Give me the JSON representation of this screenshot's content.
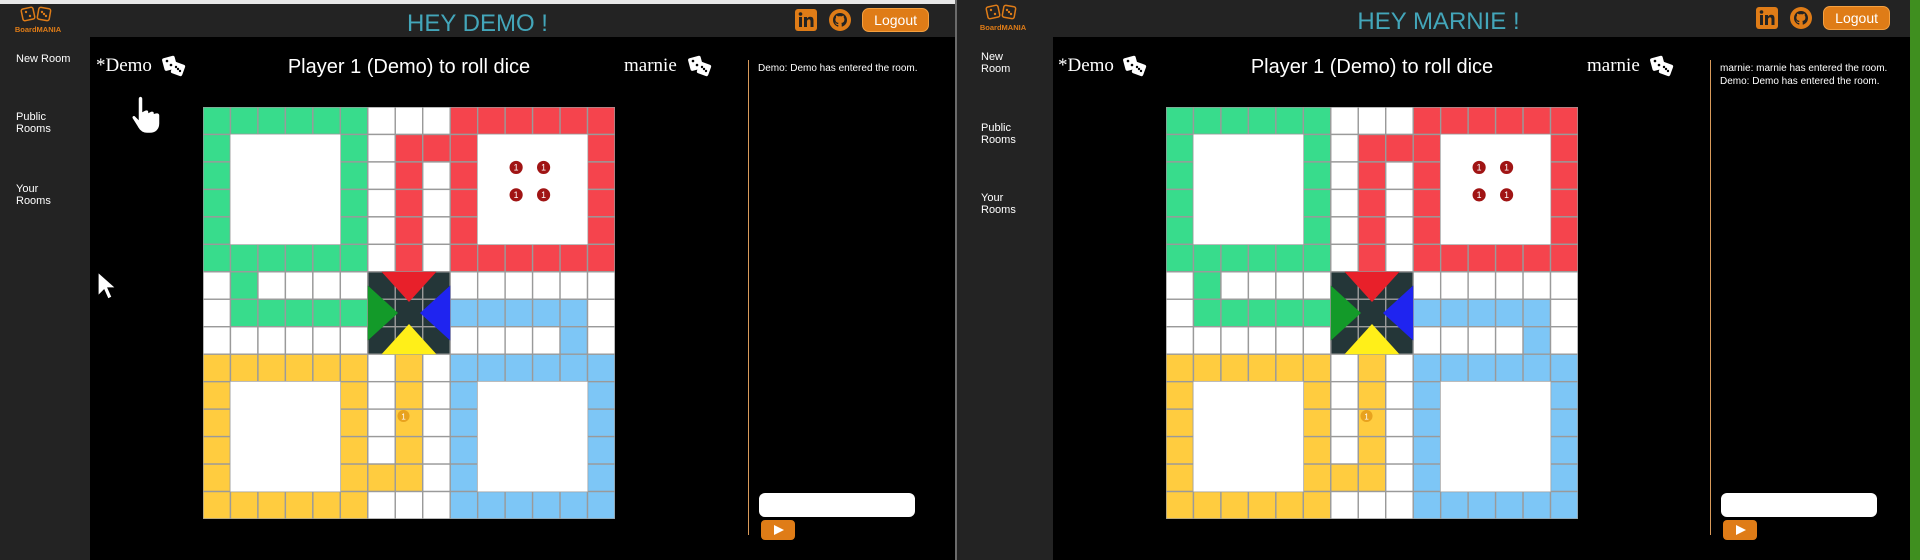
{
  "left": {
    "greeting": "HEY DEMO !",
    "logout": "Logout",
    "logo_text": "BoardMANIA",
    "sidebar": {
      "new_room": "New Room",
      "public_rooms": "Public\nRooms",
      "your_rooms": "Your\nRooms"
    },
    "player1": "*Demo",
    "player2": "marnie",
    "turn": "Player 1 (Demo) to roll dice",
    "chat": [
      "Demo: Demo has entered the room."
    ],
    "chat_placeholder": ""
  },
  "right": {
    "greeting": "HEY MARNIE !",
    "logout": "Logout",
    "logo_text": "BoardMANIA",
    "sidebar": {
      "new_room": "New\nRoom",
      "public_rooms": "Public\nRooms",
      "your_rooms": "Your\nRooms"
    },
    "player1": "*Demo",
    "player2": "marnie",
    "turn": "Player 1 (Demo) to roll dice",
    "chat": [
      "marnie: marnie has entered the room.",
      "Demo: Demo has entered the room."
    ],
    "chat_placeholder": ""
  },
  "board": {
    "colors": {
      "green": "#38dc8c",
      "red": "#f5444d",
      "yellow": "#ffcc3f",
      "blue": "#7dc6f6",
      "center": "#243638"
    },
    "tokens": {
      "red": [
        1,
        1,
        1,
        1
      ],
      "yellow_on_track": [
        1
      ]
    }
  },
  "icons": {
    "linkedin": "linkedin-icon",
    "github": "github-icon",
    "dice": "dice-icon",
    "send": "send-icon",
    "hand": "pointing-hand-icon",
    "cursor": "mouse-cursor-icon"
  }
}
